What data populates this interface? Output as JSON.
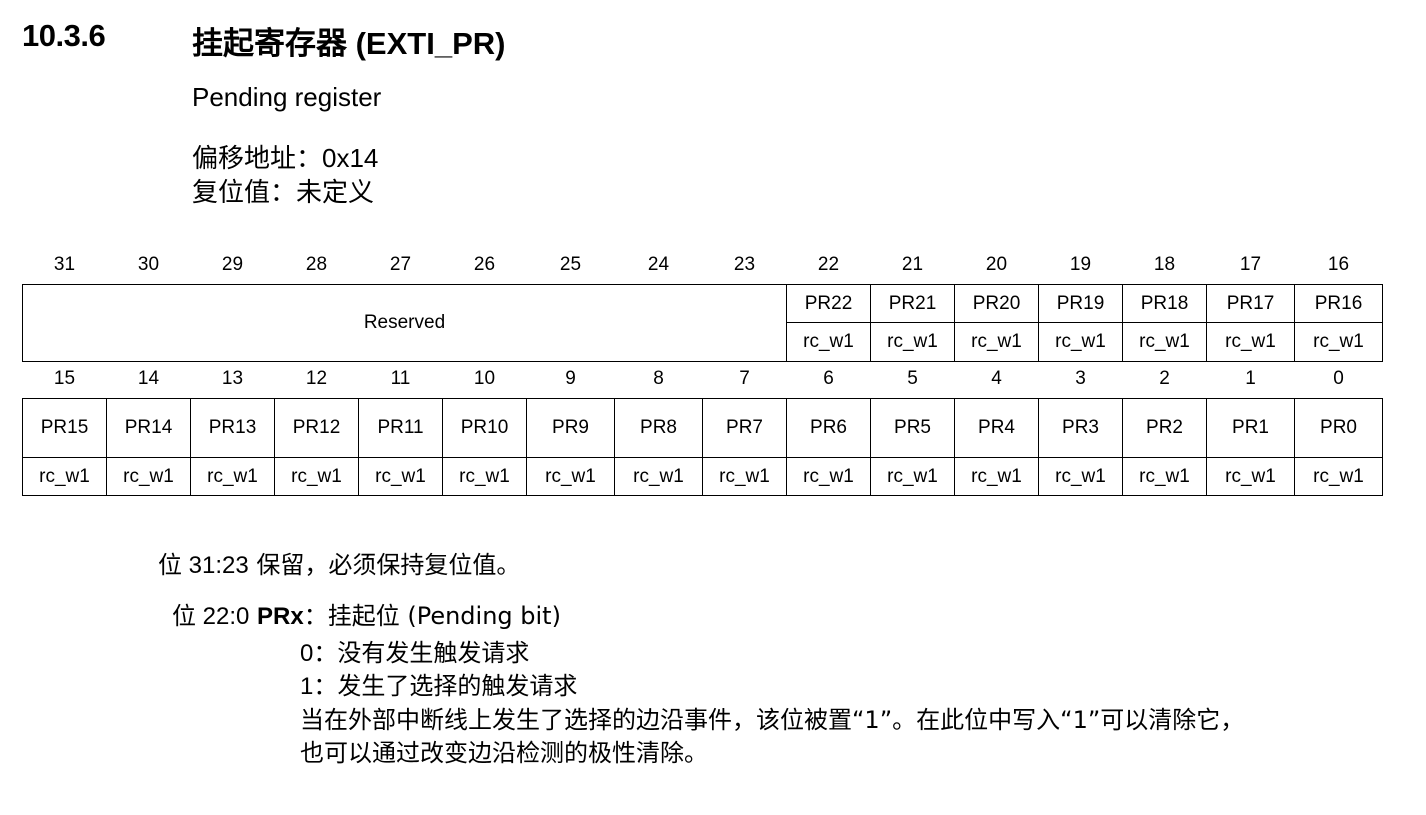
{
  "section": {
    "number": "10.3.6",
    "title": "挂起寄存器 (EXTI_PR)",
    "subtitle": "Pending register",
    "offset_label": "偏移地址：",
    "offset_value": "0x14",
    "reset_label": "复位值：",
    "reset_value": "未定义"
  },
  "register": {
    "high_bits": [
      "31",
      "30",
      "29",
      "28",
      "27",
      "26",
      "25",
      "24",
      "23",
      "22",
      "21",
      "20",
      "19",
      "18",
      "17",
      "16"
    ],
    "reserved_label": "Reserved",
    "high_fields": [
      "PR22",
      "PR21",
      "PR20",
      "PR19",
      "PR18",
      "PR17",
      "PR16"
    ],
    "high_access": [
      "rc_w1",
      "rc_w1",
      "rc_w1",
      "rc_w1",
      "rc_w1",
      "rc_w1",
      "rc_w1"
    ],
    "low_bits": [
      "15",
      "14",
      "13",
      "12",
      "11",
      "10",
      "9",
      "8",
      "7",
      "6",
      "5",
      "4",
      "3",
      "2",
      "1",
      "0"
    ],
    "low_fields": [
      "PR15",
      "PR14",
      "PR13",
      "PR12",
      "PR11",
      "PR10",
      "PR9",
      "PR8",
      "PR7",
      "PR6",
      "PR5",
      "PR4",
      "PR3",
      "PR2",
      "PR1",
      "PR0"
    ],
    "low_access": [
      "rc_w1",
      "rc_w1",
      "rc_w1",
      "rc_w1",
      "rc_w1",
      "rc_w1",
      "rc_w1",
      "rc_w1",
      "rc_w1",
      "rc_w1",
      "rc_w1",
      "rc_w1",
      "rc_w1",
      "rc_w1",
      "rc_w1",
      "rc_w1"
    ]
  },
  "descriptions": {
    "bits_31_23_label": "位 31:23",
    "bits_31_23_text": "保留，必须保持复位值。",
    "bits_22_0_label": "位 22:0",
    "bits_22_0_field": "PRx",
    "bits_22_0_sep": "：",
    "bits_22_0_text": "挂起位 (Pending bit)",
    "opt0_key": "0",
    "opt0_text": "：没有发生触发请求",
    "opt1_key": "1",
    "opt1_text": "：发生了选择的触发请求",
    "note_line1": "当在外部中断线上发生了选择的边沿事件，该位被置“1”。在此位中写入“1”可以清除它，",
    "note_line2": "也可以通过改变边沿检测的极性清除。"
  }
}
